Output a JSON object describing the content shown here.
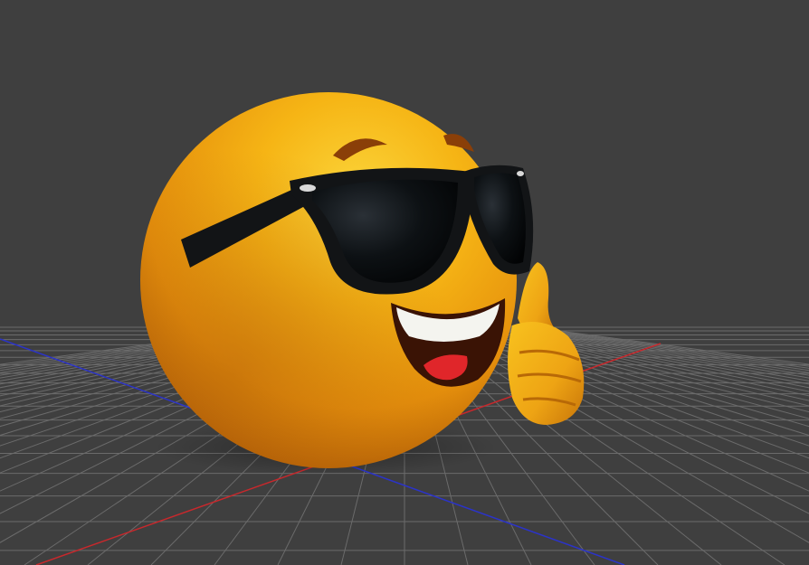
{
  "viewport": {
    "background_color": "#3f3f3f",
    "grid_line_color": "#6b6b6b",
    "x_axis_color": "#c8282c",
    "y_axis_color": "#2b33c9"
  },
  "model": {
    "kind": "emoji-sunglasses-thumbs-up",
    "skin_light": "#f8c11a",
    "skin_mid": "#f0a312",
    "skin_dark": "#c46c06",
    "lens_color": "#0a0d10",
    "frame_color": "#121416",
    "mouth_color": "#3a1305",
    "tongue_color": "#e0262a",
    "teeth_color": "#f6f6f2"
  }
}
